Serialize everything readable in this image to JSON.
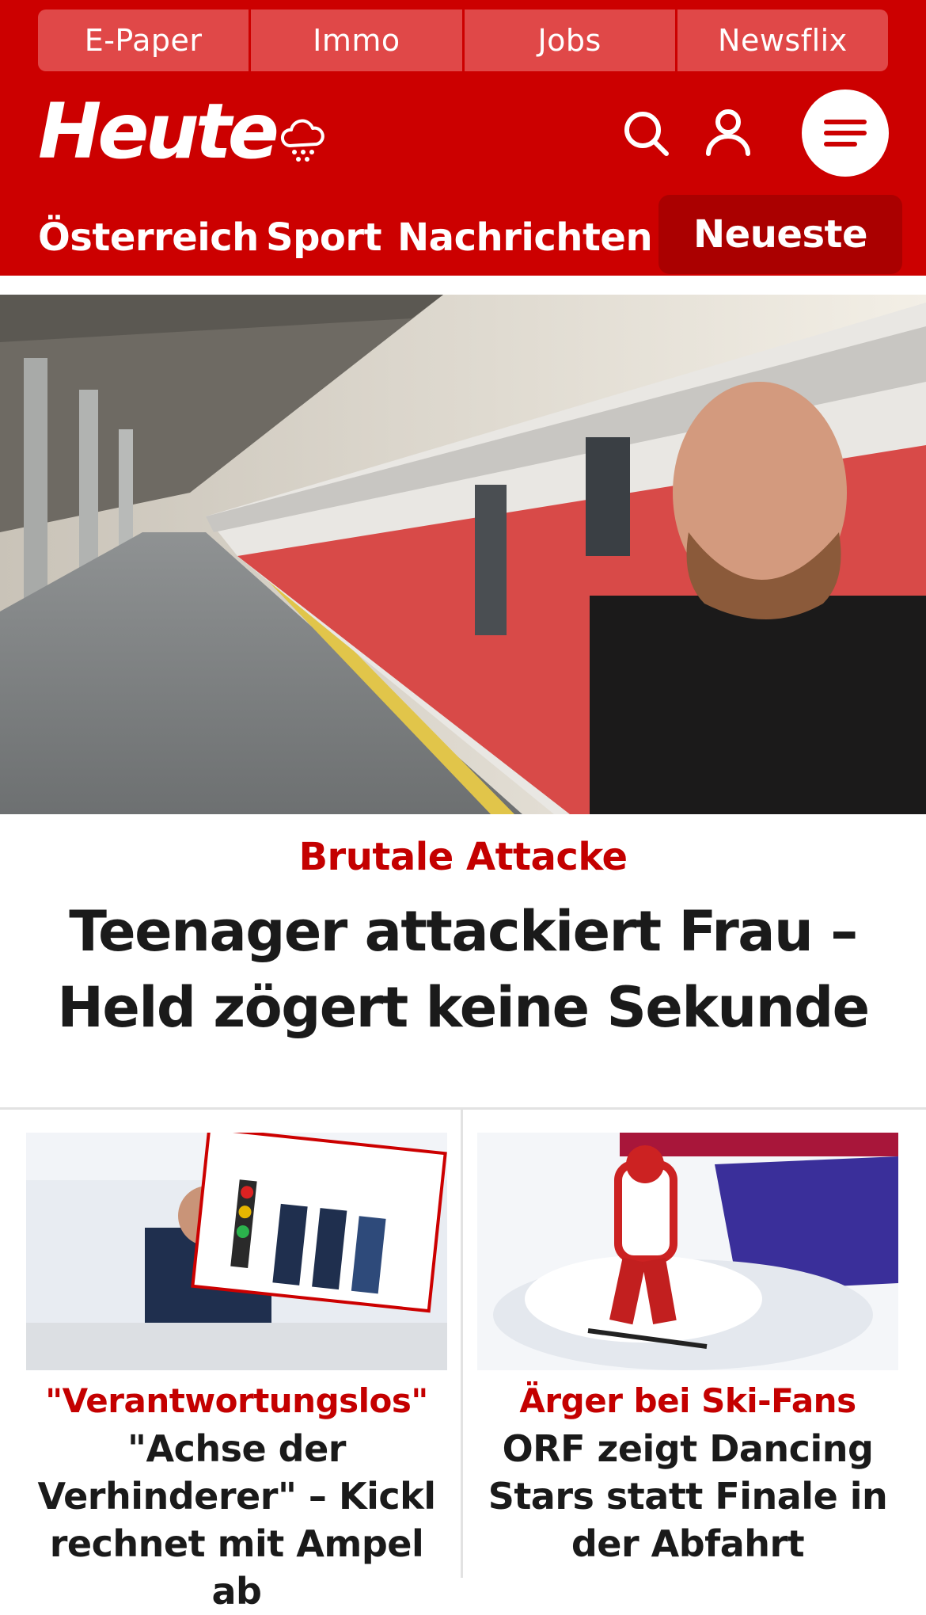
{
  "topnav": [
    "E-Paper",
    "Immo",
    "Jobs",
    "Newsflix"
  ],
  "brand": {
    "logo": "Heute",
    "weather_icon": "rain-cloud-icon"
  },
  "header_icons": {
    "search": "search-icon",
    "account": "user-icon",
    "menu": "hamburger-menu-icon"
  },
  "sections": {
    "items": [
      "Österreich",
      "Sport",
      "Nachrichten"
    ],
    "active": "Neueste"
  },
  "hero": {
    "kicker": "Brutale Attacke",
    "title": "Teenager attackiert Frau – Held zögert keine Sekunde"
  },
  "cards": [
    {
      "kicker": "\"Verantwortungslos\"",
      "title": "\"Achse der Verhinderer\" – Kickl rechnet mit Ampel ab"
    },
    {
      "kicker": "Ärger bei Ski-Fans",
      "title": "ORF zeigt Dancing Stars statt Finale in der Abfahrt"
    }
  ],
  "colors": {
    "brand_red": "#cc0000",
    "accent_dark": "#aa0000",
    "kicker_red": "#c40000"
  }
}
